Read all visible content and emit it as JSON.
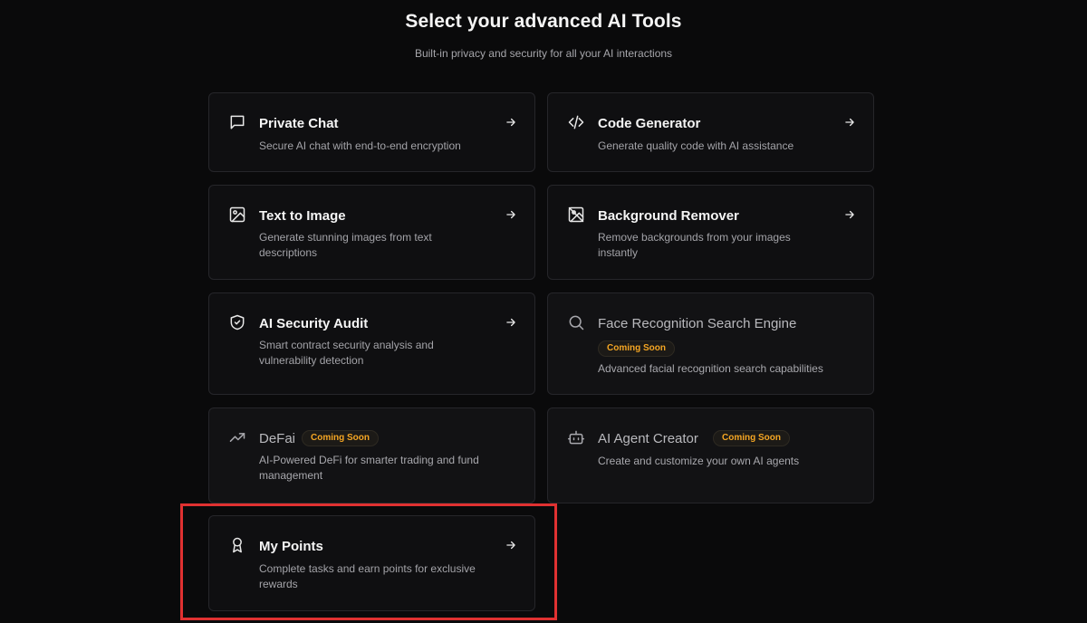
{
  "header": {
    "title": "Select your advanced AI Tools",
    "subtitle": "Built-in privacy and security for all your AI interactions"
  },
  "tools": [
    {
      "name": "Private Chat",
      "description": "Secure AI chat with end-to-end encryption",
      "icon": "chat-icon",
      "status": "available"
    },
    {
      "name": "Code Generator",
      "description": "Generate quality code with AI assistance",
      "icon": "code-icon",
      "status": "available"
    },
    {
      "name": "Text to Image",
      "description": "Generate stunning images from text descriptions",
      "icon": "image-icon",
      "status": "available"
    },
    {
      "name": "Background Remover",
      "description": "Remove backgrounds from your images instantly",
      "icon": "image-off-icon",
      "status": "available"
    },
    {
      "name": "AI Security Audit",
      "description": "Smart contract security analysis and vulnerability detection",
      "icon": "shield-check-icon",
      "status": "available"
    },
    {
      "name": "Face Recognition Search Engine",
      "description": "Advanced facial recognition search capabilities",
      "icon": "search-icon",
      "status": "coming-soon",
      "badge": "Coming Soon"
    },
    {
      "name": "DeFai",
      "description": "AI-Powered DeFi for smarter trading and fund management",
      "icon": "trending-up-icon",
      "status": "coming-soon",
      "badge": "Coming Soon"
    },
    {
      "name": "AI Agent Creator",
      "description": "Create and customize your own AI agents",
      "icon": "bot-icon",
      "status": "coming-soon",
      "badge": "Coming Soon"
    },
    {
      "name": "My Points",
      "description": "Complete tasks and earn points for exclusive rewards",
      "icon": "award-icon",
      "status": "available"
    }
  ],
  "colors": {
    "background": "#0a0a0b",
    "card": "#0f0f11",
    "badge_text": "#f5a623",
    "highlight": "#e03131"
  }
}
